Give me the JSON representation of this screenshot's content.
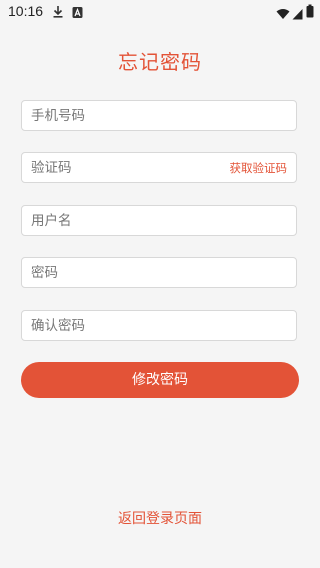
{
  "status_bar": {
    "time": "10:16",
    "icons": [
      "download-icon",
      "a-notification-icon",
      "wifi-icon",
      "signal-icon",
      "battery-icon"
    ]
  },
  "page": {
    "title": "忘记密码"
  },
  "form": {
    "phone_placeholder": "手机号码",
    "code_placeholder": "验证码",
    "get_code_label": "获取验证码",
    "username_placeholder": "用户名",
    "password_placeholder": "密码",
    "confirm_password_placeholder": "确认密码",
    "submit_label": "修改密码"
  },
  "footer": {
    "back_label": "返回登录页面"
  },
  "colors": {
    "accent": "#e35337",
    "background": "#f5f5f5"
  }
}
